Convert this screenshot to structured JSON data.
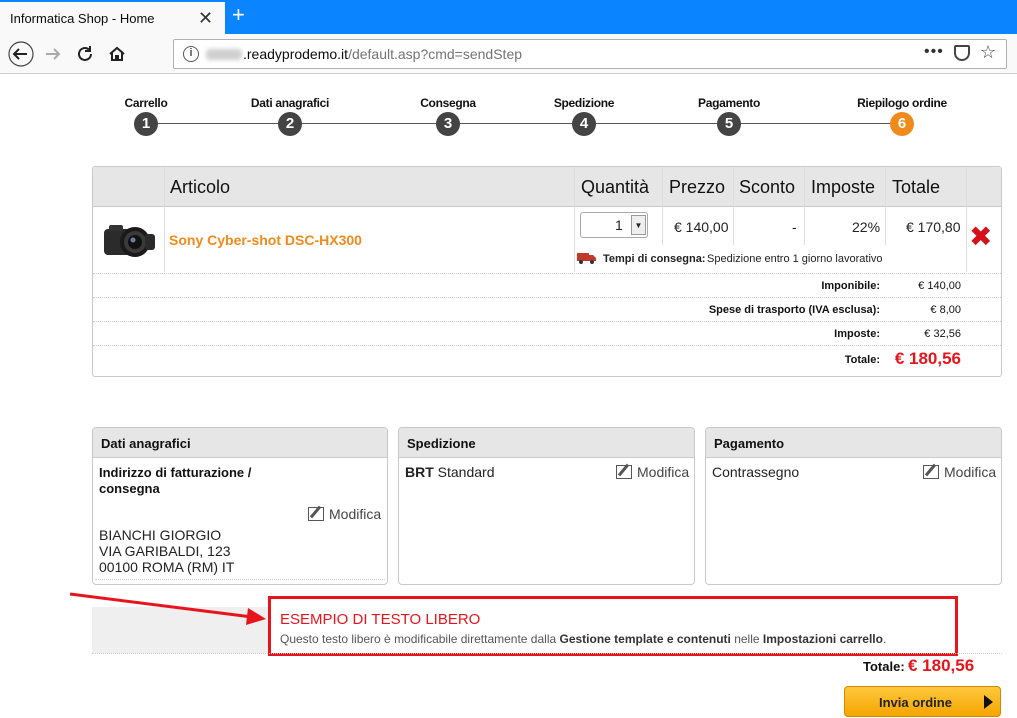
{
  "browser": {
    "tab_title": "Informatica Shop - Home",
    "close_glyph": "✕",
    "newtab_glyph": "+",
    "url_domain": ".readyprodemo.it",
    "url_path": "/default.asp?cmd=sendStep",
    "more_glyph": "•••"
  },
  "steps": [
    {
      "label": "Carrello",
      "num": "1"
    },
    {
      "label": "Dati anagrafici",
      "num": "2"
    },
    {
      "label": "Consegna",
      "num": "3"
    },
    {
      "label": "Spedizione",
      "num": "4"
    },
    {
      "label": "Pagamento",
      "num": "5"
    },
    {
      "label": "Riepilogo ordine",
      "num": "6"
    }
  ],
  "cart": {
    "headers": {
      "article": "Articolo",
      "qty": "Quantità",
      "price": "Prezzo",
      "discount": "Sconto",
      "tax": "Imposte",
      "total": "Totale"
    },
    "item": {
      "name": "Sony Cyber-shot DSC-HX300",
      "qty": "1",
      "price": "€ 140,00",
      "discount": "-",
      "tax": "22%",
      "total": "€ 170,80",
      "delivery_label": "Tempi di consegna:",
      "delivery_text": "Spedizione entro 1 giorno lavorativo",
      "remove_glyph": "✖"
    },
    "summary": [
      {
        "label": "Imponibile:",
        "value": "€ 140,00"
      },
      {
        "label": "Spese di trasporto (IVA esclusa):",
        "value": "€ 8,00"
      },
      {
        "label": "Imposte:",
        "value": "€ 32,56"
      }
    ],
    "total_label": "Totale:",
    "total_value": "€ 180,56"
  },
  "panels": {
    "registry": {
      "title": "Dati anagrafici",
      "address_title_1": "Indirizzo di fatturazione /",
      "address_title_2": "consegna",
      "edit": "Modifica",
      "line1": "BIANCHI GIORGIO",
      "line2": "VIA GARIBALDI, 123",
      "line3": "00100 ROMA (RM) IT"
    },
    "shipping": {
      "title": "Spedizione",
      "carrier": "BRT",
      "method": "Standard",
      "edit": "Modifica"
    },
    "payment": {
      "title": "Pagamento",
      "method": "Contrassegno",
      "edit": "Modifica"
    }
  },
  "free_text": {
    "title": "ESEMPIO DI TESTO LIBERO",
    "desc_1": "Questo testo libero è modificabile direttamente dalla ",
    "desc_bold_1": "Gestione template e contenuti",
    "desc_2": " nelle ",
    "desc_bold_2": "Impostazioni carrello",
    "desc_3": "."
  },
  "footer": {
    "total_label": "Totale:",
    "total_value": "€ 180,56",
    "send_label": "Invia ordine"
  },
  "colors": {
    "accent": "#f08a1a",
    "red": "#e8141c",
    "browser_blue": "#0a84ff"
  }
}
